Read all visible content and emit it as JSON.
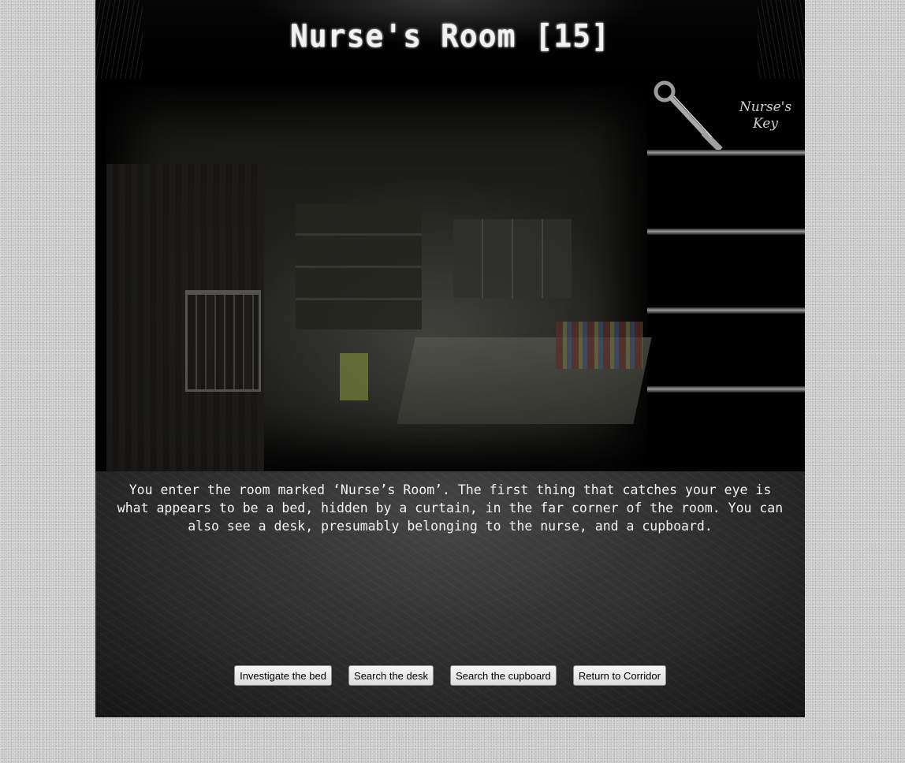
{
  "room": {
    "title": "Nurse's Room [15]"
  },
  "inventory": {
    "slots": [
      {
        "item": "Nurse's\nKey",
        "icon": "key-icon"
      },
      {
        "item": "",
        "icon": ""
      },
      {
        "item": "",
        "icon": ""
      },
      {
        "item": "",
        "icon": ""
      },
      {
        "item": "",
        "icon": ""
      }
    ]
  },
  "scene": {
    "description": "You enter the room marked ‘Nurse’s Room’. The first thing that catches your eye is what appears to be a bed, hidden by a curtain, in the far corner of the room. You can also see a desk, presumably belonging to the nurse, and a cupboard."
  },
  "actions": {
    "investigate_bed": "Investigate the bed",
    "search_desk": "Search the desk",
    "search_cupboard": "Search the cupboard",
    "return_corridor": "Return to Corridor"
  },
  "colors": {
    "frame": "#000000",
    "page_background": "#c9c9c9",
    "text": "#f3f3f3"
  }
}
